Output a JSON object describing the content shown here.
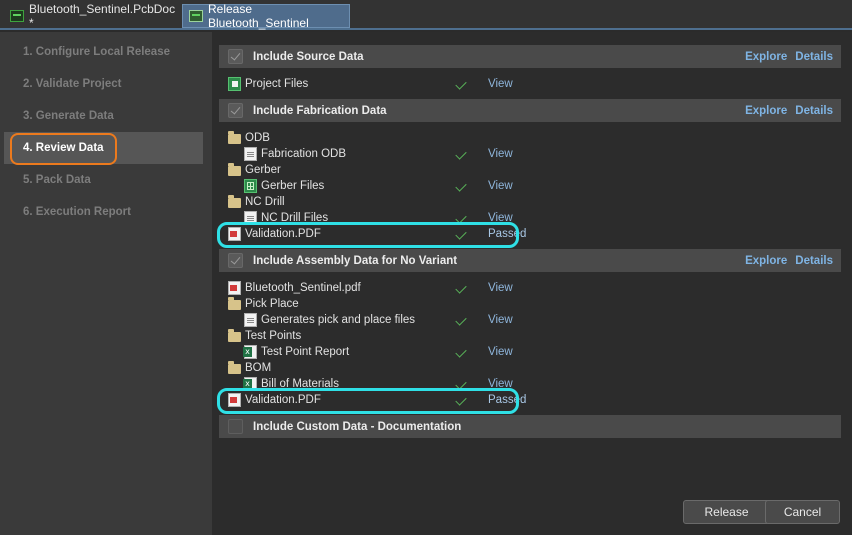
{
  "tabs": [
    {
      "label": "Bluetooth_Sentinel.PcbDoc *"
    },
    {
      "label": "Release Bluetooth_Sentinel"
    }
  ],
  "steps": [
    {
      "label": "1. Configure Local Release"
    },
    {
      "label": "2. Validate Project"
    },
    {
      "label": "3. Generate Data"
    },
    {
      "label": "4. Review Data"
    },
    {
      "label": "5. Pack Data"
    },
    {
      "label": "6. Execution Report"
    }
  ],
  "sections": {
    "source": {
      "title": "Include Source Data",
      "explore": "Explore",
      "details": "Details"
    },
    "fabrication": {
      "title": "Include Fabrication Data",
      "explore": "Explore",
      "details": "Details"
    },
    "assembly": {
      "title": "Include Assembly Data for No Variant",
      "explore": "Explore",
      "details": "Details"
    },
    "custom": {
      "title": "Include Custom Data - Documentation"
    }
  },
  "rows": {
    "project_files": {
      "name": "Project Files",
      "status": "View"
    },
    "odb": {
      "name": "ODB"
    },
    "fabrication_odb": {
      "name": "Fabrication ODB",
      "status": "View"
    },
    "gerber": {
      "name": "Gerber"
    },
    "gerber_files": {
      "name": "Gerber Files",
      "status": "View"
    },
    "nc_drill": {
      "name": "NC Drill"
    },
    "nc_drill_files": {
      "name": "NC Drill Files",
      "status": "View"
    },
    "fab_validation": {
      "name": "Validation.PDF",
      "status": "Passed"
    },
    "assembly_pdf": {
      "name": "Bluetooth_Sentinel.pdf",
      "status": "View"
    },
    "pick_place": {
      "name": "Pick Place"
    },
    "pick_place_files": {
      "name": "Generates pick and place files",
      "status": "View"
    },
    "test_points": {
      "name": "Test Points"
    },
    "test_point_report": {
      "name": "Test Point Report",
      "status": "View"
    },
    "bom": {
      "name": "BOM"
    },
    "bill_of_materials": {
      "name": "Bill of Materials",
      "status": "View"
    },
    "asm_validation": {
      "name": "Validation.PDF",
      "status": "Passed"
    }
  },
  "buttons": {
    "release": "Release",
    "cancel": "Cancel"
  },
  "colors": {
    "highlight_step": "#ec7a1d",
    "highlight_row": "#2fe0e6",
    "link": "#7fb4e4",
    "check": "#59b459"
  }
}
